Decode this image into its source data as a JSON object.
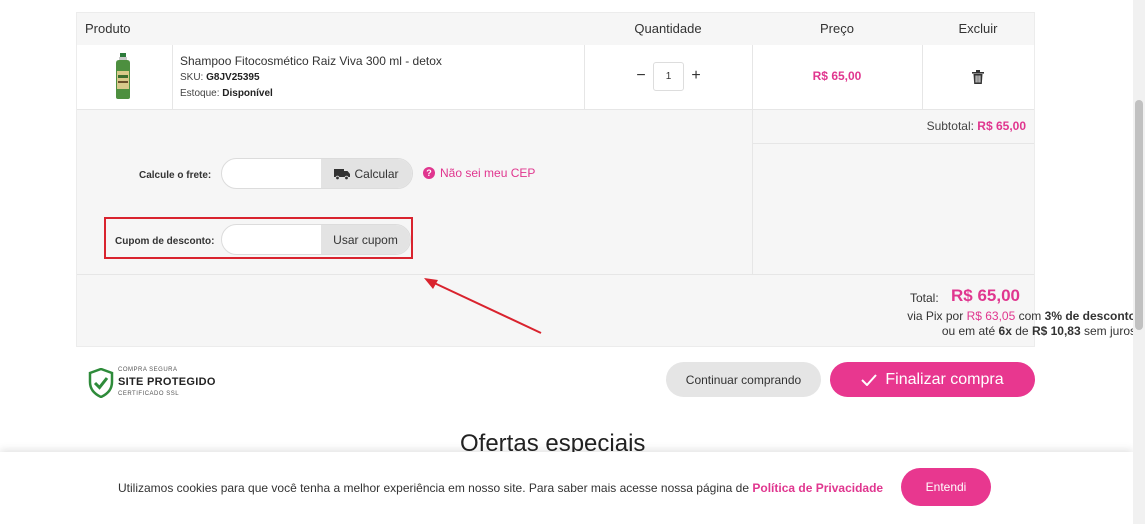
{
  "table": {
    "headers": {
      "product": "Produto",
      "quantity": "Quantidade",
      "price": "Preço",
      "delete": "Excluir"
    },
    "item": {
      "name": "Shampoo Fitocosmético Raiz Viva 300 ml - detox",
      "sku_label": "SKU:",
      "sku": "G8JV25395",
      "stock_label": "Estoque:",
      "stock": "Disponível",
      "quantity": "1",
      "minus": "−",
      "plus": "+",
      "price": "R$ 65,00"
    },
    "subtotal_label": "Subtotal:",
    "subtotal_value": "R$ 65,00"
  },
  "shipping": {
    "label": "Calcule o frete:",
    "button": "Calcular",
    "help_link": "Não sei meu CEP",
    "help_icon": "?"
  },
  "coupon": {
    "label": "Cupom de desconto:",
    "button": "Usar cupom"
  },
  "totals": {
    "total_label": "Total:",
    "total_value": "R$ 65,00",
    "pix_prefix": "via Pix por",
    "pix_value": "R$ 63,05",
    "pix_with": "com",
    "pix_discount": "3% de desconto",
    "install_prefix": "ou em até",
    "install_count": "6x",
    "install_of": "de",
    "install_value": "R$ 10,83",
    "install_suffix": "sem juros"
  },
  "seal": {
    "top": "COMPRA SEGURA",
    "main": "SITE PROTEGIDO",
    "bottom": "CERTIFICADO SSL"
  },
  "actions": {
    "continue": "Continuar comprando",
    "finish": "Finalizar compra"
  },
  "offers_heading": "Ofertas especiais",
  "cookie": {
    "text": "Utilizamos cookies para que você tenha a melhor experiência em nosso site. Para saber mais acesse nossa página de",
    "link": "Política de Privacidade",
    "button": "Entendi"
  },
  "colors": {
    "accent": "#e8378f",
    "highlight": "#d9232e",
    "seal_green": "#2e8b3a"
  },
  "icons": {
    "truck": "truck-icon",
    "trash": "trash-icon",
    "check": "check-icon",
    "shield": "shield-check-icon",
    "question": "question-circle-icon"
  }
}
